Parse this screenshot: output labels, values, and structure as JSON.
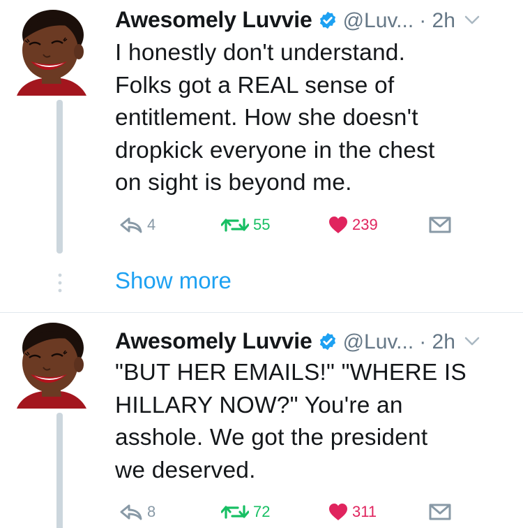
{
  "tweets": [
    {
      "author_name": "Awesomely Luvvie",
      "handle": "@Luv...",
      "time": "· 2h",
      "text_lines": [
        "I honestly don't understand.",
        "Folks got a REAL sense of",
        "entitlement. How she doesn't",
        "dropkick everyone in the chest",
        "on sight is beyond me."
      ],
      "replies": "4",
      "retweets": "55",
      "likes": "239"
    },
    {
      "author_name": "Awesomely Luvvie",
      "handle": "@Luv...",
      "time": "· 2h",
      "text_lines": [
        "\"BUT HER EMAILS!\" \"WHERE IS",
        "HILLARY NOW?\" You're an",
        "asshole. We got the president",
        "we deserved."
      ],
      "replies": "8",
      "retweets": "72",
      "likes": "311"
    }
  ],
  "show_more_label": "Show more",
  "colors": {
    "retweet": "#17bf63",
    "like": "#e0245e",
    "link": "#1da1f2",
    "muted": "#8899a6",
    "verified": "#1da1f2"
  },
  "icons": [
    "verified-badge-icon",
    "chevron-down-icon",
    "reply-icon",
    "retweet-icon",
    "heart-icon",
    "direct-message-icon",
    "more-dots-icon"
  ]
}
